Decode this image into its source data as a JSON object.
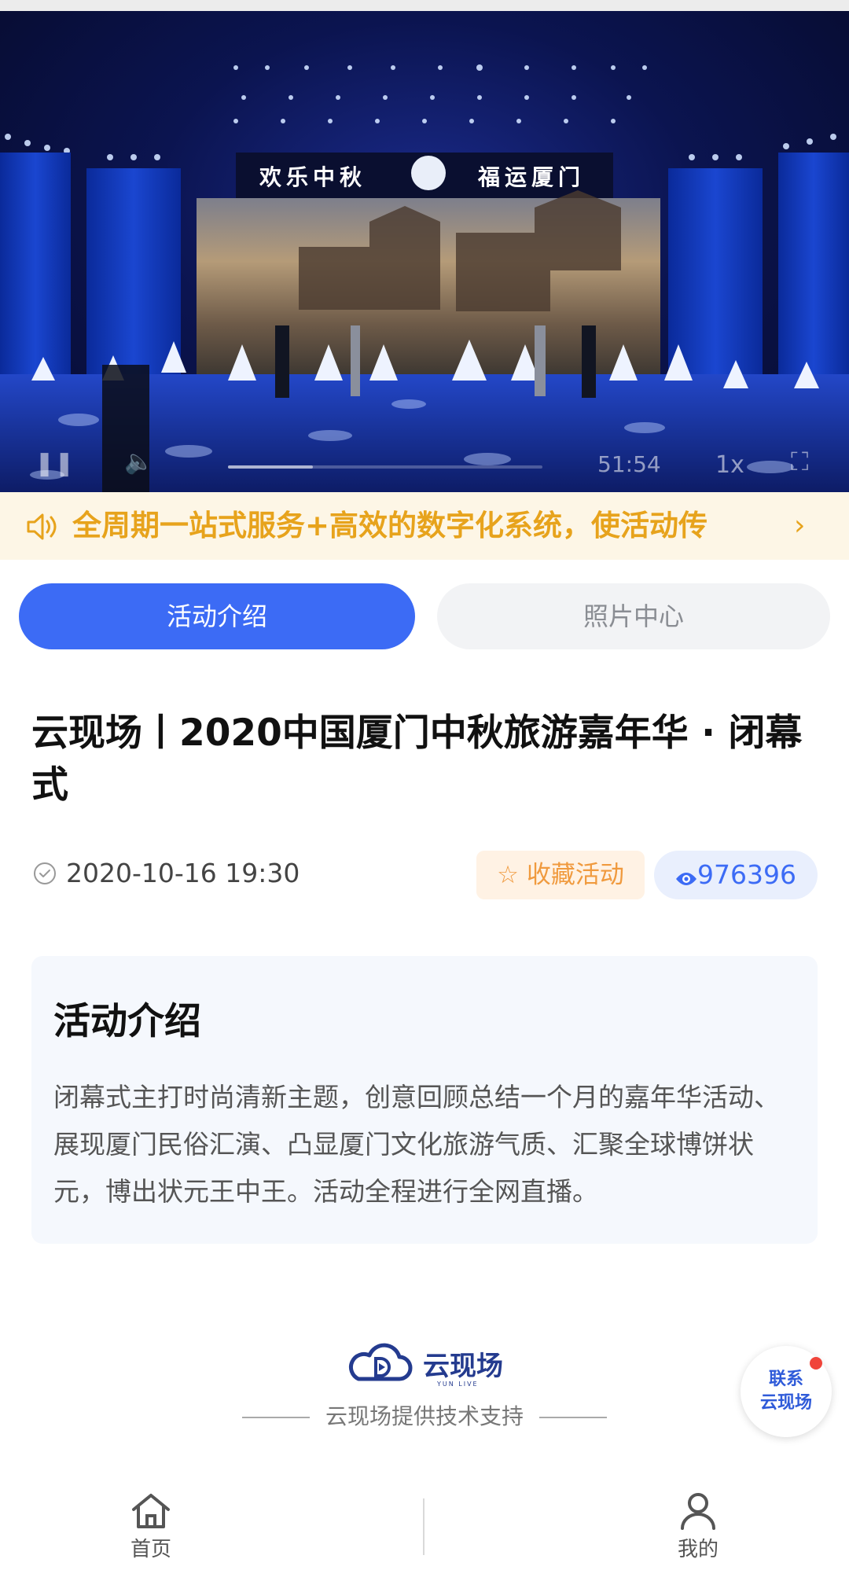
{
  "video": {
    "banner_left": "欢乐中秋",
    "banner_right": "福运厦门",
    "time": "51:54",
    "speed": "1x",
    "progress": 0.27
  },
  "notice": {
    "text": "全周期一站式服务+高效的数字化系统，使活动传",
    "icons": {
      "speaker": "speaker-icon",
      "more": "chevron-right-icon"
    }
  },
  "tabs": [
    {
      "label": "活动介绍",
      "active": true
    },
    {
      "label": "照片中心",
      "active": false
    }
  ],
  "event": {
    "title": "云现场丨2020中国厦门中秋旅游嘉年华 · 闭幕式",
    "datetime": "2020-10-16 19:30",
    "favorite_label": "收藏活动",
    "views": "976396"
  },
  "intro": {
    "heading": "活动介绍",
    "body": "闭幕式主打时尚清新主题，创意回顾总结一个月的嘉年华活动、展现厦门民俗汇演、凸显厦门文化旅游气质、汇聚全球博饼状元，博出状元王中王。活动全程进行全网直播。"
  },
  "footer": {
    "brand": "云现场",
    "brand_sub": "YUN LIVE",
    "tech_support": "云现场提供技术支持"
  },
  "contact": {
    "line1": "联系",
    "line2": "云现场"
  },
  "nav": {
    "home": "首页",
    "mine": "我的"
  },
  "colors": {
    "primary": "#3c6bf5",
    "notice": "#e7a31c",
    "favorite": "#f09a3e",
    "brand": "#243b8f"
  }
}
